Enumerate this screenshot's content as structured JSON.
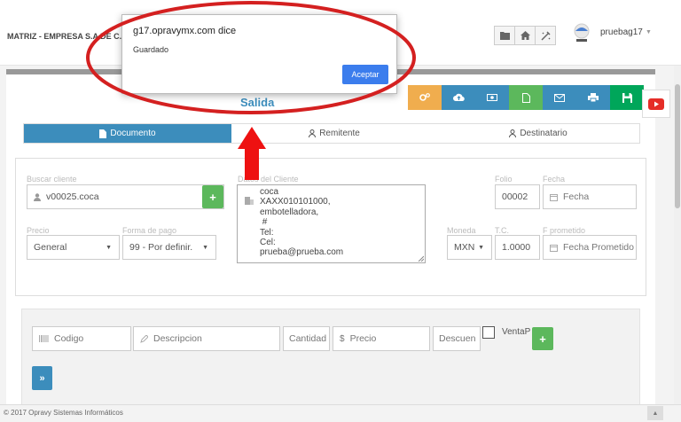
{
  "header": {
    "company": "MATRIZ - EMPRESA S.A DE C.V",
    "username": "pruebag17",
    "icons": [
      "folder-icon",
      "home-icon",
      "tools-icon"
    ]
  },
  "page": {
    "title": "Salida"
  },
  "toolbar": {
    "buttons": [
      {
        "icon": "cogs-icon",
        "color": "#f0ad4e"
      },
      {
        "icon": "cloud-upload-icon",
        "color": "#3c8dbc"
      },
      {
        "icon": "money-icon",
        "color": "#3c8dbc"
      },
      {
        "icon": "file-icon",
        "color": "#5cb85c"
      },
      {
        "icon": "envelope-icon",
        "color": "#3c8dbc"
      },
      {
        "icon": "print-icon",
        "color": "#3c8dbc"
      },
      {
        "icon": "save-icon",
        "color": "#00a65a"
      }
    ]
  },
  "tabs": [
    "Documento",
    "Remitente",
    "Destinatario"
  ],
  "form": {
    "buscar_cliente_label": "Buscar cliente",
    "buscar_cliente_value": "v00025.coca",
    "datos_cliente_label": "Datos del Cliente",
    "datos_cliente_lines": [
      "coca",
      "XAXX010101000,",
      "embotelladora,",
      " #",
      "Tel:",
      "Cel:",
      "prueba@prueba.com"
    ],
    "folio_label": "Folio",
    "folio_value": "00002",
    "fecha_label": "Fecha",
    "fecha_placeholder": "Fecha",
    "precio_label": "Precio",
    "precio_value": "General",
    "forma_pago_label": "Forma de pago",
    "forma_pago_value": "99 - Por definir.",
    "moneda_label": "Moneda",
    "moneda_value": "MXN",
    "tc_label": "T.C.",
    "tc_value": "1.0000",
    "fprometido_label": "F prometido",
    "fprometido_placeholder": "Fecha Prometido"
  },
  "items": {
    "codigo_placeholder": "Codigo",
    "descripcion_placeholder": "Descripcion",
    "cantidad_placeholder": "Cantidad",
    "precio_placeholder": "Precio",
    "descuento_placeholder": "Descuen",
    "venta_label": "VentaP"
  },
  "footer": {
    "text": "© 2017 Opravy Sistemas Informáticos"
  },
  "dialog": {
    "title": "g17.opravymx.com dice",
    "message": "Guardado",
    "accept_label": "Aceptar"
  },
  "colors": {
    "primary": "#3c8dbc",
    "success": "#5cb85c",
    "warning": "#f0ad4e",
    "dialog_button": "#3b7ded",
    "annotation": "#d42020"
  }
}
